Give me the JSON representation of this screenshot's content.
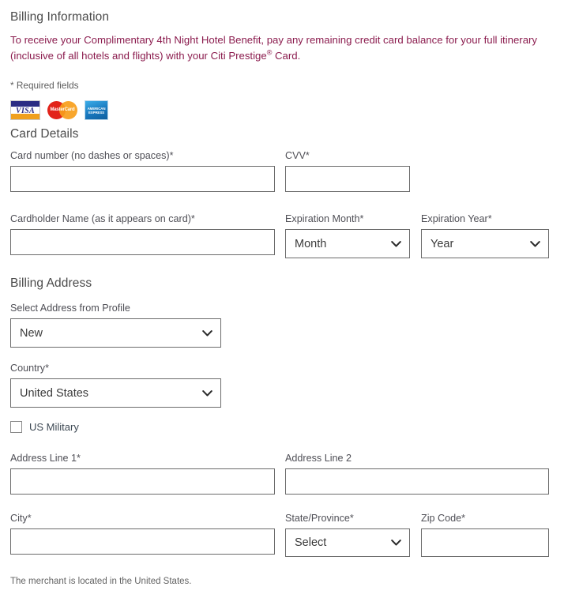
{
  "headings": {
    "billing_information": "Billing Information",
    "card_details": "Card Details",
    "billing_address": "Billing Address"
  },
  "notice": {
    "line": "To receive your Complimentary 4th Night Hotel Benefit, pay any remaining credit card balance for your full itinerary (inclusive of all hotels and flights) with your Citi Prestige",
    "registered_mark": "®",
    "suffix": " Card.",
    "color": "#8b1c4e"
  },
  "required_note": "* Required fields",
  "card_logos": [
    {
      "name": "visa",
      "text": "VISA"
    },
    {
      "name": "mastercard",
      "text": "MasterCard"
    },
    {
      "name": "american-express",
      "text": "AMERICAN EXPRESS"
    }
  ],
  "card_details": {
    "card_number": {
      "label": "Card number (no dashes or spaces)*",
      "value": "",
      "placeholder": ""
    },
    "cvv": {
      "label": "CVV*",
      "value": "",
      "placeholder": ""
    },
    "cardholder_name": {
      "label": "Cardholder Name (as it appears on card)*",
      "value": "",
      "placeholder": ""
    },
    "expiration_month": {
      "label": "Expiration Month*",
      "value": "Month"
    },
    "expiration_year": {
      "label": "Expiration Year*",
      "value": "Year"
    }
  },
  "billing_address": {
    "select_address": {
      "label": "Select Address from Profile",
      "value": "New"
    },
    "country": {
      "label": "Country*",
      "value": "United States"
    },
    "us_military": {
      "label": "US Military",
      "checked": false
    },
    "address_line_1": {
      "label": "Address Line 1*",
      "value": "",
      "placeholder": ""
    },
    "address_line_2": {
      "label": "Address Line 2",
      "value": "",
      "placeholder": ""
    },
    "city": {
      "label": "City*",
      "value": "",
      "placeholder": ""
    },
    "state_province": {
      "label": "State/Province*",
      "value": "Select"
    },
    "zip_code": {
      "label": "Zip Code*",
      "value": "",
      "placeholder": ""
    }
  },
  "footer_note": "The merchant is located in the United States."
}
